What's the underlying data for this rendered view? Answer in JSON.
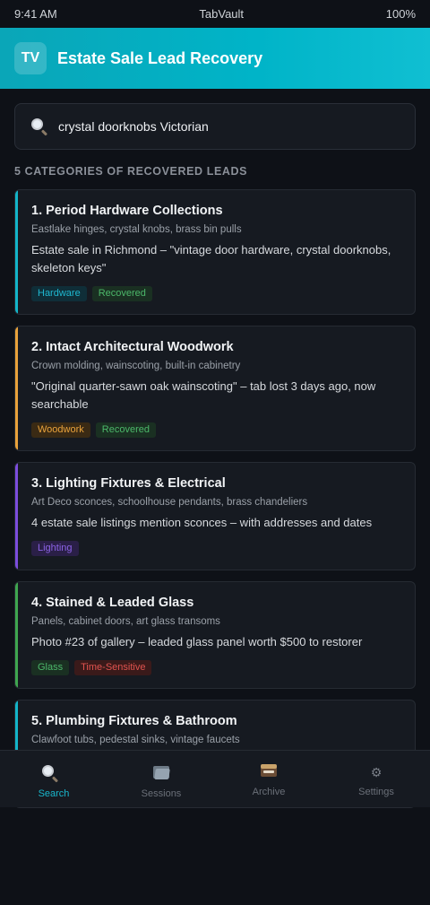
{
  "status": {
    "time": "9:41 AM",
    "app": "TabVault",
    "battery": "100%"
  },
  "header": {
    "logo": "TV",
    "title": "Estate Sale Lead Recovery"
  },
  "search": {
    "value": "crystal doorknobs Victorian",
    "icon": "search-icon"
  },
  "section": {
    "title": "5 CATEGORIES OF RECOVERED LEADS"
  },
  "cards": [
    {
      "title": "1. Period Hardware Collections",
      "subtitle": "Eastlake hinges, crystal knobs, brass bin pulls",
      "description": "Estate sale in Richmond – \"vintage door hardware, crystal doorknobs, skeleton keys\"",
      "accent": "#13b5c9",
      "tags": [
        {
          "label": "Hardware",
          "color": "#1fb8d0",
          "bg": "#0f2e38"
        },
        {
          "label": "Recovered",
          "color": "#4cb86a",
          "bg": "#1a3022"
        }
      ]
    },
    {
      "title": "2. Intact Architectural Woodwork",
      "subtitle": "Crown molding, wainscoting, built-in cabinetry",
      "description": "\"Original quarter-sawn oak wainscoting\" – tab lost 3 days ago, now searchable",
      "accent": "#e9a23b",
      "tags": [
        {
          "label": "Woodwork",
          "color": "#e9a23b",
          "bg": "#3a2a14"
        },
        {
          "label": "Recovered",
          "color": "#4cb86a",
          "bg": "#1a3022"
        }
      ]
    },
    {
      "title": "3. Lighting Fixtures & Electrical",
      "subtitle": "Art Deco sconces, schoolhouse pendants, brass chandeliers",
      "description": "4 estate sale listings mention sconces – with addresses and dates",
      "accent": "#7c4ddd",
      "tags": [
        {
          "label": "Lighting",
          "color": "#8c63e6",
          "bg": "#2a1f47"
        }
      ]
    },
    {
      "title": "4. Stained & Leaded Glass",
      "subtitle": "Panels, cabinet doors, art glass transoms",
      "description": "Photo #23 of gallery – leaded glass panel worth $500 to restorer",
      "accent": "#3fa64f",
      "tags": [
        {
          "label": "Glass",
          "color": "#4cb86a",
          "bg": "#1a3022"
        },
        {
          "label": "Time-Sensitive",
          "color": "#e0534f",
          "bg": "#3a1a1a"
        }
      ]
    },
    {
      "title": "5. Plumbing Fixtures & Bathroom",
      "subtitle": "Clawfoot tubs, pedestal sinks, vintage faucets",
      "description": "",
      "accent": "#13b5c9",
      "tags": []
    }
  ],
  "tabbar": {
    "search": "Search",
    "sessions": "Sessions",
    "archive": "Archive",
    "settings": "Settings"
  }
}
